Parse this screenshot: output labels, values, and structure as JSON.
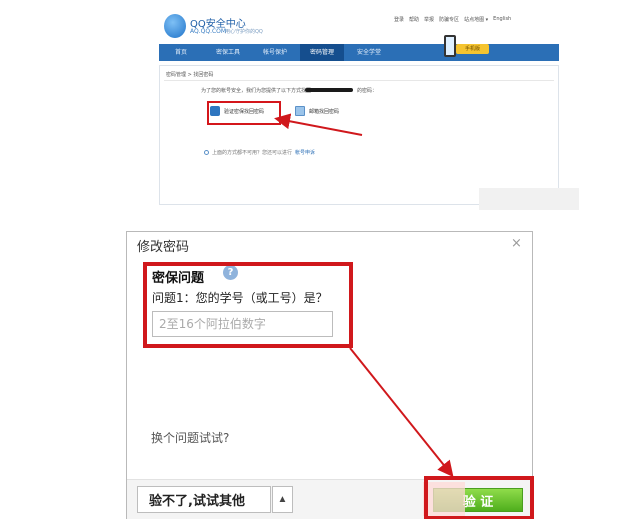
{
  "top_screenshot": {
    "site_title": "QQ安全中心",
    "site_domain": "AQ.QQ.COM",
    "site_slogan": "用心守护你的QQ",
    "top_links": [
      "登录",
      "帮助",
      "举报",
      "防骗专区",
      "站点地图 ▾",
      "English"
    ],
    "nav_items": [
      "首页",
      "密保工具",
      "帐号保护",
      "密码管理",
      "安全学堂"
    ],
    "nav_active_index": 3,
    "phone_badge": "手机版",
    "breadcrumb": "密码管理 > 找回密码",
    "intro_text": "为了您的帐号安全，我们为您提供了以下方式找回",
    "intro_tail": "的密码：",
    "option_key_label": "验证密保找回密码",
    "option_mail_label": "邮箱找回密码",
    "bottom_note": "上面的方式都不可用？您还可以进行",
    "bottom_note_link": "帐号申诉"
  },
  "dialog": {
    "title": "修改密码",
    "close_glyph": "×",
    "question_heading": "密保问题",
    "help_glyph": "?",
    "question_text": "问题1：您的学号（或工号）是？",
    "answer_placeholder": "2至16个阿拉伯数字",
    "answer_value": "",
    "switch_question": "换个问题试试?",
    "try_other_label": "验不了,试试其他",
    "try_other_arrow": "▲",
    "verify_label": "验 证"
  },
  "colors": {
    "highlight_red": "#d0181c",
    "nav_blue": "#2b6fb6",
    "verify_green": "#4fae1d"
  },
  "icons": [
    "qq-logo-icon",
    "key-icon",
    "mail-icon",
    "help-icon",
    "close-icon",
    "phone-icon"
  ]
}
